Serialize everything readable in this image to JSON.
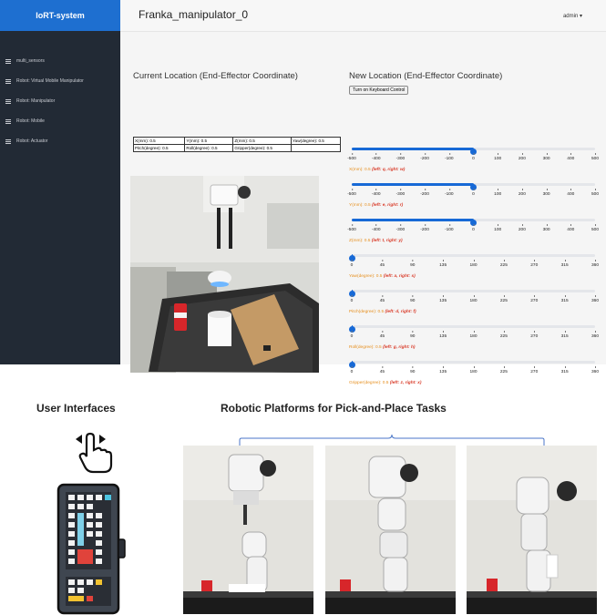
{
  "app": {
    "brand": "IoRT-system",
    "title": "Franka_manipulator_0",
    "user": "admin"
  },
  "sidebar": {
    "items": [
      {
        "label": "multi_sensors"
      },
      {
        "label": "Robot: Virtual Mobile Manipulator"
      },
      {
        "label": "Robot: Manipulator"
      },
      {
        "label": "Robot: Mobile"
      },
      {
        "label": "Robot: Actuator"
      }
    ]
  },
  "current": {
    "title": "Current Location (End-Effector Coordinate)",
    "rows": [
      [
        "X(mm): 0.5",
        "Y(mm): 0.5",
        "Z(mm): 0.5",
        "Yaw(degree): 0.5"
      ],
      [
        "Pitch(degree): 0.5",
        "Roll(degree): 0.5",
        "Gripper(degree): 0.5",
        ""
      ]
    ]
  },
  "new_location": {
    "title": "New Location (End-Effector Coordinate)",
    "keyboard_button": "Turn on Keyboard Control"
  },
  "sliders": [
    {
      "label": "X(mm): 0.5",
      "keys": "(left: q, right: w)",
      "min": -500,
      "max": 500,
      "value": 0.5,
      "ticks": [
        "-500",
        "-400",
        "-300",
        "-200",
        "-100",
        "0",
        "100",
        "200",
        "300",
        "400",
        "500"
      ]
    },
    {
      "label": "Y(mm): 0.5",
      "keys": "(left: e, right: r)",
      "min": -500,
      "max": 500,
      "value": 0.5,
      "ticks": [
        "-500",
        "-400",
        "-300",
        "-200",
        "-100",
        "0",
        "100",
        "200",
        "300",
        "400",
        "500"
      ]
    },
    {
      "label": "Z(mm): 0.5",
      "keys": "(left: t, right: y)",
      "min": -500,
      "max": 500,
      "value": 0.5,
      "ticks": [
        "-500",
        "-400",
        "-300",
        "-200",
        "-100",
        "0",
        "100",
        "200",
        "300",
        "400",
        "500"
      ]
    },
    {
      "label": "Yaw(degree): 0.5",
      "keys": "(left: a, right: s)",
      "min": 0,
      "max": 360,
      "value": 0.5,
      "ticks": [
        "0",
        "45",
        "90",
        "135",
        "180",
        "225",
        "270",
        "315",
        "360"
      ]
    },
    {
      "label": "Pitch(degree): 0.5",
      "keys": "(left: d, right: f)",
      "min": 0,
      "max": 360,
      "value": 0.5,
      "ticks": [
        "0",
        "45",
        "90",
        "135",
        "180",
        "225",
        "270",
        "315",
        "360"
      ]
    },
    {
      "label": "Roll(degree): 0.5",
      "keys": "(left: g, right: h)",
      "min": 0,
      "max": 360,
      "value": 0.5,
      "ticks": [
        "0",
        "45",
        "90",
        "135",
        "180",
        "225",
        "270",
        "315",
        "360"
      ]
    },
    {
      "label": "Gripper(degree): 0.5",
      "keys": "(left: z, right: x)",
      "min": 0,
      "max": 360,
      "value": 0.5,
      "ticks": [
        "0",
        "45",
        "90",
        "135",
        "180",
        "225",
        "270",
        "315",
        "360"
      ]
    }
  ],
  "captions": {
    "user_interfaces": "User Interfaces",
    "robotic_platforms": "Robotic Platforms for Pick-and-Place Tasks"
  },
  "colors": {
    "brand": "#1e6fd0",
    "sidebar": "#222a35",
    "slider": "#1769d6",
    "slider_label": "#e69020",
    "slider_keys": "#d93c2a"
  }
}
